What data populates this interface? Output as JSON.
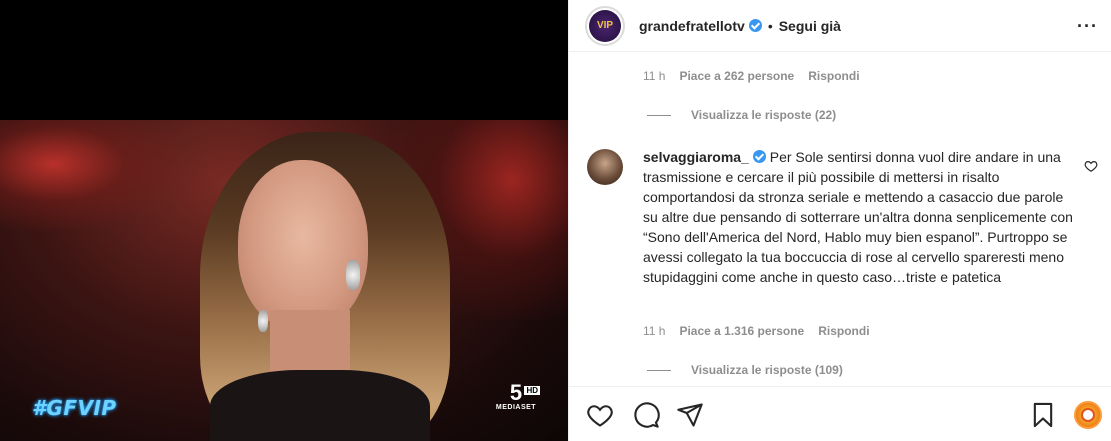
{
  "media": {
    "tv_tag": "#GFVIP",
    "channel_number": "5",
    "channel_hd": "HD",
    "channel_brand": "MEDIASET"
  },
  "header": {
    "username": "grandefratellotv",
    "separator": "•",
    "follow_state": "Segui già",
    "avatar_text": "VIP"
  },
  "comment_prev": {
    "time": "11 h",
    "likes": "Piace a 262 persone",
    "reply": "Rispondi",
    "view_replies": "Visualizza le risposte (22)"
  },
  "comment": {
    "user": "selvaggiaroma_",
    "text": "Per Sole sentirsi donna vuol dire andare in una trasmissione e cercare il più possibile di mettersi in risalto comportandosi da stronza seriale e mettendo a casaccio due parole su altre due pensando di sotterrare un'altra donna senplicemente con “Sono dell'America del Nord, Hablo muy bien espanol”. Purtroppo se avessi collegato la tua boccuccia di rose al cervello spareresti meno stupidaggini come anche in questo caso…triste e patetica",
    "time": "11 h",
    "likes": "Piace a 1.316 persone",
    "reply": "Rispondi",
    "view_replies": "Visualizza le risposte (109)"
  }
}
